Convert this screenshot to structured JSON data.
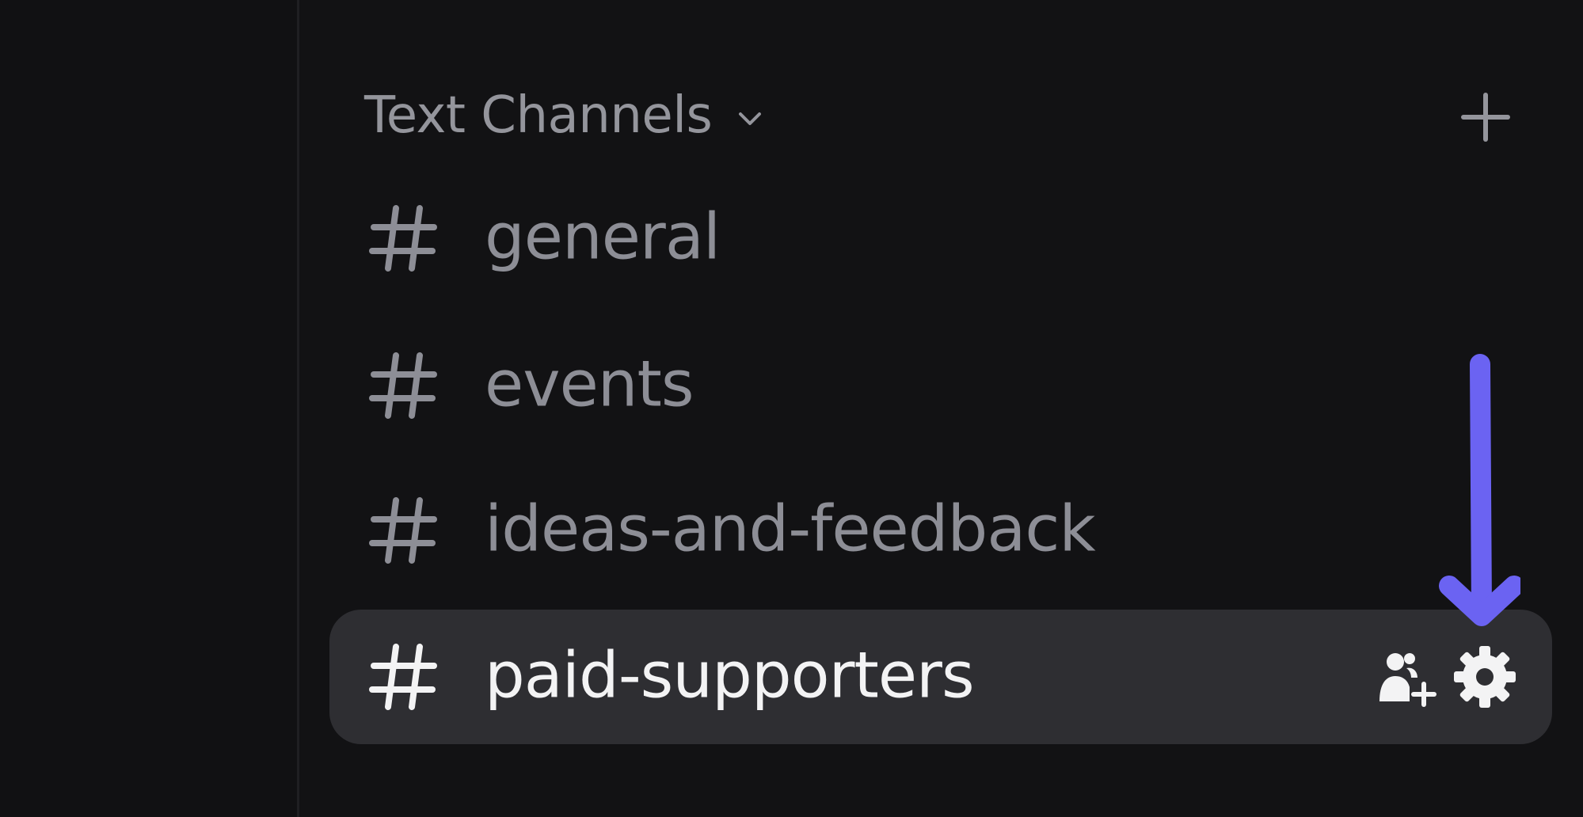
{
  "sidebar": {
    "category": {
      "label": "Text Channels"
    },
    "channels": [
      {
        "name": "general",
        "selected": false
      },
      {
        "name": "events",
        "selected": false
      },
      {
        "name": "ideas-and-feedback",
        "selected": false
      },
      {
        "name": "paid-supporters",
        "selected": true
      }
    ],
    "icons": {
      "category_toggle": "chevron-down-icon",
      "add": "plus-icon",
      "channel": "hash-icon",
      "invite": "add-member-icon",
      "settings": "gear-icon"
    }
  },
  "annotation": {
    "type": "arrow-pointing-down",
    "color": "#6b63f2"
  },
  "colors": {
    "background": "#121214",
    "selected_row": "#2e2e32",
    "muted_text": "#8d8e96",
    "selected_text": "#f3f3f4"
  }
}
